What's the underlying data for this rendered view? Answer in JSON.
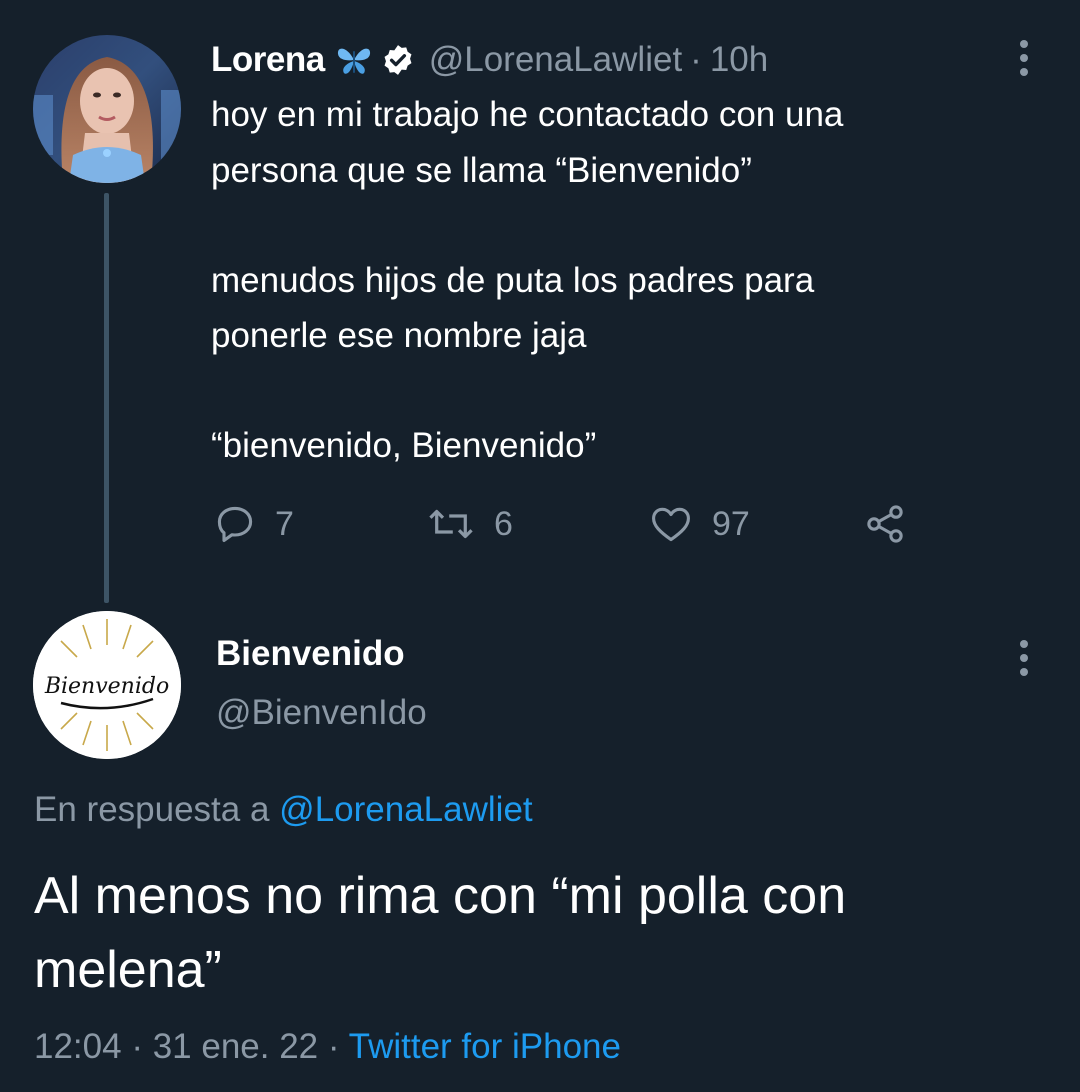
{
  "tweet1": {
    "display_name": "Lorena",
    "name_emoji_icon": "butterfly-icon",
    "verified_icon": "verified-badge-icon",
    "handle": "@LorenaLawliet",
    "separator": "·",
    "time_ago": "10h",
    "text_lines": [
      "hoy en mi trabajo he contactado con una",
      "persona que se llama “Bienvenido”",
      "menudos hijos de puta los padres para",
      "ponerle ese nombre jaja",
      "“bienvenido, Bienvenido”"
    ],
    "actions": {
      "replies": "7",
      "retweets": "6",
      "likes": "97"
    }
  },
  "tweet2": {
    "display_name": "Bienvenido",
    "handle": "@BienvenIdo",
    "avatar_text": "Bienvenido",
    "reply_prefix": "En respuesta a",
    "reply_handle": "@LorenaLawliet",
    "text_lines": [
      "Al menos no rima con “mi polla con",
      "melena”"
    ],
    "time": "12:04",
    "date": "31 ene. 22",
    "separator": "·",
    "source": "Twitter for iPhone"
  },
  "colors": {
    "background": "#15202b",
    "text": "#ffffff",
    "muted": "#8b98a5",
    "accent": "#1d9bf0",
    "thread_line": "#3d5466"
  }
}
